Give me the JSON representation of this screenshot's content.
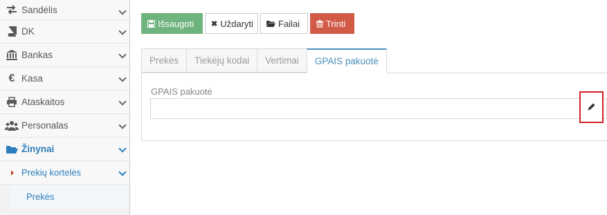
{
  "sidebar": {
    "items": [
      {
        "label": "Sandėlis",
        "icon": "exchange-icon"
      },
      {
        "label": "DK",
        "icon": "book-icon"
      },
      {
        "label": "Bankas",
        "icon": "bank-icon"
      },
      {
        "label": "Kasa",
        "icon": "euro-icon"
      },
      {
        "label": "Ataskaitos",
        "icon": "printer-icon"
      },
      {
        "label": "Personalas",
        "icon": "users-icon"
      },
      {
        "label": "Žinynai",
        "icon": "folder-open-icon"
      }
    ],
    "submenu": {
      "label": "Prekių kortelės"
    },
    "submenu2": {
      "label": "Prekės"
    }
  },
  "toolbar": {
    "save_label": "Išsaugoti",
    "close_label": "Uždaryti",
    "files_label": "Failai",
    "delete_label": "Trinti"
  },
  "tabs": [
    {
      "label": "Prekės"
    },
    {
      "label": "Tiekėjų kodai"
    },
    {
      "label": "Vertimai"
    },
    {
      "label": "GPAIS pakuotė"
    }
  ],
  "form": {
    "field_label": "GPAIS pakuotė",
    "field_value": ""
  },
  "colors": {
    "accent": "#2b7dbc",
    "save": "#6fb37e",
    "delete": "#d15b47",
    "highlight": "#d32020"
  }
}
